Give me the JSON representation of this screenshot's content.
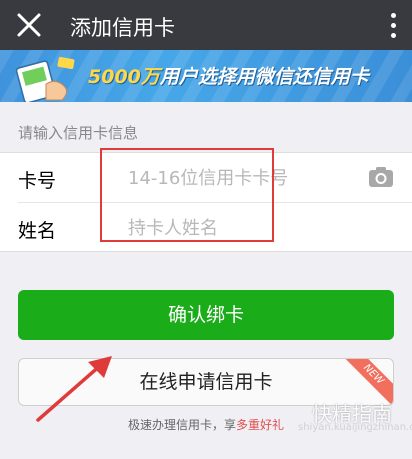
{
  "header": {
    "title": "添加信用卡",
    "close_icon": "close-icon",
    "more_icon": "more-vertical-icon"
  },
  "banner": {
    "promo_number": "5000万",
    "promo_text": "用户选择用微信还信用卡"
  },
  "form": {
    "section_label": "请输入信用卡信息",
    "card_number": {
      "label": "卡号",
      "placeholder": "14-16位信用卡卡号",
      "value": ""
    },
    "name": {
      "label": "姓名",
      "placeholder": "持卡人姓名",
      "value": ""
    },
    "camera_icon": "camera-icon"
  },
  "actions": {
    "confirm_label": "确认绑卡",
    "apply_label": "在线申请信用卡",
    "new_badge": "NEW"
  },
  "footer": {
    "note_prefix": "极速办理信用卡，享",
    "note_highlight": "多重好礼"
  },
  "watermark": {
    "brand": "快精指南",
    "sub": "shiyan.kuaijingzhinan.com"
  },
  "colors": {
    "titlebar": "#393a3f",
    "primary_green": "#1aad19",
    "banner_blue": "#46a7e8",
    "annotation_red": "#e03b3b",
    "gift_red": "#e05050"
  }
}
